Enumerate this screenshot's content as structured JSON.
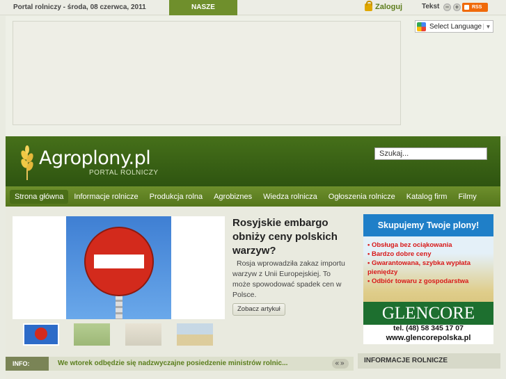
{
  "topbar": {
    "date": "Portal rolniczy - środa, 08 czerwca, 2011",
    "announcements": "NASZE OGŁOSZENIA",
    "login": "Zaloguj",
    "text_size_label": "Tekst",
    "minus": "−",
    "plus": "+",
    "rss": "RSS"
  },
  "language": {
    "label": "Select Language",
    "arrow": "▼"
  },
  "header": {
    "logo_name": "Agroplony.pl",
    "logo_sub": "PORTAL ROLNICZY",
    "search_value": "Szukaj..."
  },
  "nav": {
    "items": [
      "Strona główna",
      "Informacje rolnicze",
      "Produkcja rolna",
      "Agrobiznes",
      "Wiedza rolnicza",
      "Ogłoszenia rolnicze",
      "Katalog firm",
      "Filmy"
    ]
  },
  "featured": {
    "title": "Rosyjskie embargo obniży ceny polskich warzyw?",
    "text": "Rosja wprowadziła zakaz importu warzyw z Unii Europejskiej. To może spowodować spadek cen w Polsce.",
    "read_more": "Zobacz artykuł"
  },
  "info": {
    "label": "INFO:",
    "text": "We wtorek odbędzie się nadzwyczajne posiedzenie ministrów rolnic...",
    "nav": "«»"
  },
  "side_ad": {
    "headline": "Skupujemy Twoje plony!",
    "bullets": [
      "Obsługa bez ociąkowania",
      "Bardzo dobre ceny",
      "Gwarantowana, szybka wypłata pieniędzy",
      "Odbiór towaru z gospodarstwa"
    ],
    "brand": "GLENCORE",
    "tel": "tel. (48) 58 345 17 07",
    "web": "www.glencorepolska.pl"
  },
  "sidebar": {
    "heading": "INFORMACJE ROLNICZE"
  },
  "colors": {
    "header_green": "#3e6417",
    "nav_green": "#628424",
    "accent_orange": "#f06a0a"
  }
}
